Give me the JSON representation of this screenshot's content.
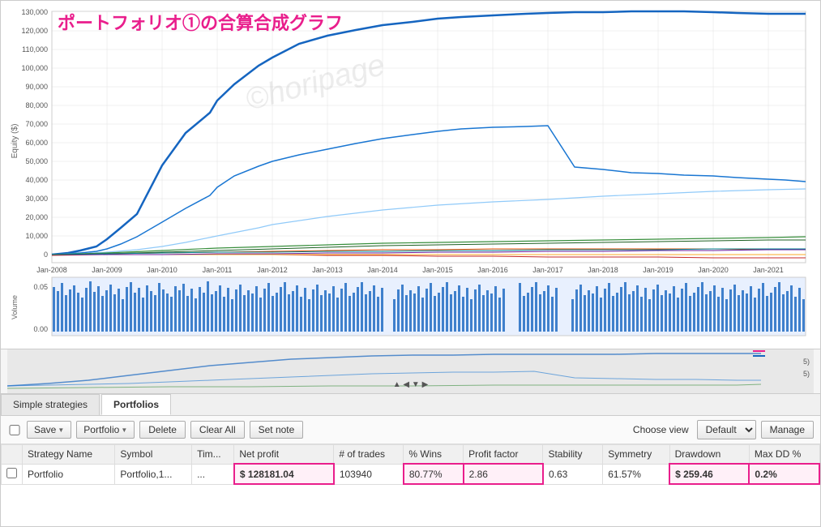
{
  "title": "ポートフォリオ①の合算合成グラフ",
  "watermark": "©horipage",
  "chart": {
    "y_axis_label": "Equity ($)",
    "y_ticks": [
      "130,000",
      "120,000",
      "110,000",
      "100,000",
      "90,000",
      "80,000",
      "70,000",
      "60,000",
      "50,000",
      "40,000",
      "30,000",
      "20,000",
      "10,000",
      "0"
    ],
    "volume_ticks": [
      "0.05",
      "0.00"
    ],
    "x_ticks": [
      "Jan-2008",
      "Jan-2009",
      "Jan-2010",
      "Jan-2011",
      "Jan-2012",
      "Jan-2013",
      "Jan-2014",
      "Jan-2015",
      "Jan-2016",
      "Jan-2017",
      "Jan-2018",
      "Jan-2019",
      "Jan-2020",
      "Jan-2021"
    ]
  },
  "tabs": [
    {
      "label": "Simple strategies",
      "active": false
    },
    {
      "label": "Portfolios",
      "active": true
    }
  ],
  "toolbar": {
    "save_label": "Save",
    "portfolio_label": "Portfolio",
    "delete_label": "Delete",
    "clear_all_label": "Clear All",
    "set_note_label": "Set note",
    "choose_view_label": "Choose view",
    "default_label": "Default",
    "manage_label": "Manage"
  },
  "table": {
    "headers": [
      "",
      "Strategy Name",
      "Symbol",
      "Tim...",
      "Net profit",
      "# of trades",
      "% Wins",
      "Profit factor",
      "Stability",
      "Symmetry",
      "Drawdown",
      "Max DD %"
    ],
    "rows": [
      {
        "checked": false,
        "name": "Portfolio",
        "symbol": "Portfolio,1...",
        "tim": "...",
        "net_profit": "$ 128181.04",
        "trades": "103940",
        "wins": "80.77%",
        "profit_factor": "2.86",
        "stability": "0.63",
        "symmetry": "61.57%",
        "drawdown": "$ 259.46",
        "max_dd": "0.2%"
      }
    ]
  },
  "navigator": {
    "line1": "5)",
    "line2": "5)"
  }
}
